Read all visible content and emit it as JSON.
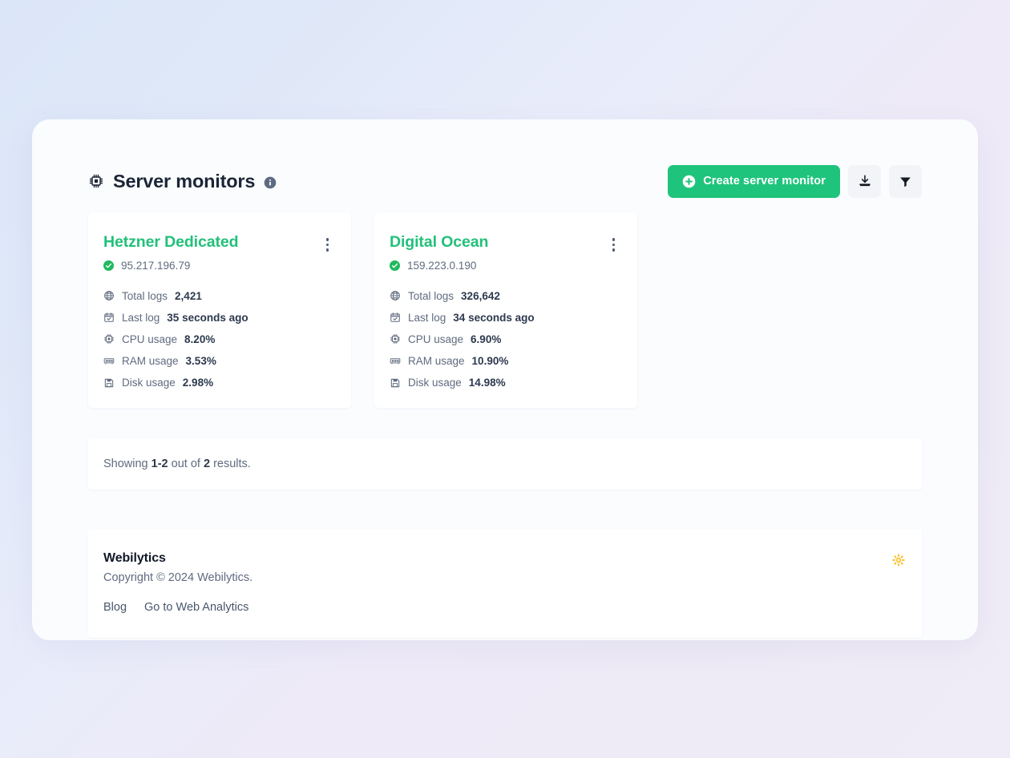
{
  "header": {
    "title": "Server monitors",
    "chip_icon": "cpu-chip-icon",
    "info_icon": "info-circle-icon",
    "create_button_label": "Create server monitor",
    "create_button_icon": "plus-circle-icon",
    "export_icon": "download-icon",
    "filter_icon": "funnel-filter-icon",
    "accent_color": "#1fc47c",
    "icon_button_bg": "#f3f4f7"
  },
  "monitors": [
    {
      "name": "Hetzner Dedicated",
      "ip": "95.217.196.79",
      "status_icon": "check-circle-icon",
      "status_color": "#21b95f",
      "menu_icon": "kebab-menu-icon",
      "stats": [
        {
          "icon": "globe-icon",
          "label": "Total logs",
          "value": "2,421"
        },
        {
          "icon": "calendar-check-icon",
          "label": "Last log",
          "value": "35 seconds ago"
        },
        {
          "icon": "cpu-chip-icon",
          "label": "CPU usage",
          "value": "8.20%"
        },
        {
          "icon": "memory-ram-icon",
          "label": "RAM usage",
          "value": "3.53%"
        },
        {
          "icon": "hard-disk-icon",
          "label": "Disk usage",
          "value": "2.98%"
        }
      ]
    },
    {
      "name": "Digital Ocean",
      "ip": "159.223.0.190",
      "status_icon": "check-circle-icon",
      "status_color": "#21b95f",
      "menu_icon": "kebab-menu-icon",
      "stats": [
        {
          "icon": "globe-icon",
          "label": "Total logs",
          "value": "326,642"
        },
        {
          "icon": "calendar-check-icon",
          "label": "Last log",
          "value": "34 seconds ago"
        },
        {
          "icon": "cpu-chip-icon",
          "label": "CPU usage",
          "value": "6.90%"
        },
        {
          "icon": "memory-ram-icon",
          "label": "RAM usage",
          "value": "10.90%"
        },
        {
          "icon": "hard-disk-icon",
          "label": "Disk usage",
          "value": "14.98%"
        }
      ]
    }
  ],
  "results": {
    "prefix": "Showing ",
    "range": "1-2",
    "middle": " out of ",
    "total": "2",
    "suffix": " results."
  },
  "footer": {
    "brand": "Webilytics",
    "copyright": "Copyright © 2024 Webilytics.",
    "links": [
      {
        "label": "Blog"
      },
      {
        "label": "Go to Web Analytics"
      }
    ],
    "theme_icon": "sun-icon",
    "theme_icon_color": "#f9bc14"
  }
}
